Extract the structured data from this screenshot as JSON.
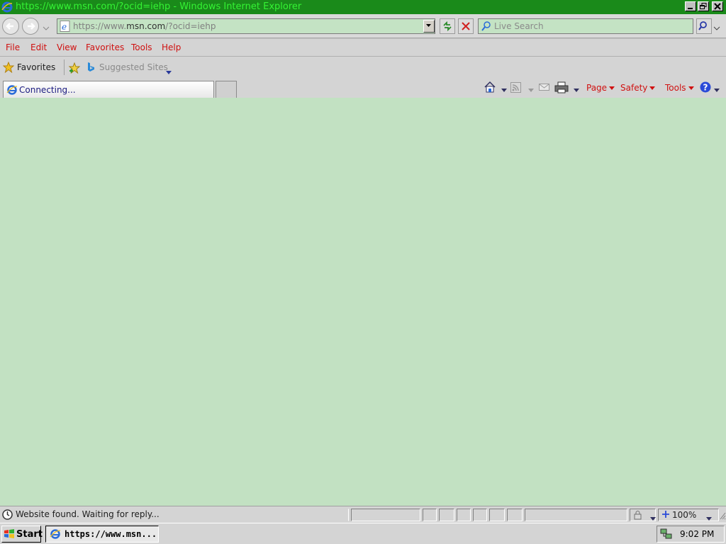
{
  "window": {
    "title": "https://www.msn.com/?ocid=iehp - Windows Internet Explorer"
  },
  "address_bar": {
    "url_prefix": "https://www.",
    "url_domain": "msn.com",
    "url_suffix": "/?ocid=iehp"
  },
  "search": {
    "placeholder": "Live Search"
  },
  "menu": [
    "File",
    "Edit",
    "View",
    "Favorites",
    "Tools",
    "Help"
  ],
  "favorites_bar": {
    "favorites_label": "Favorites",
    "suggested_sites_label": "Suggested Sites"
  },
  "tab": {
    "label": "Connecting..."
  },
  "command_bar": {
    "page_label": "Page",
    "safety_label": "Safety",
    "tools_label": "Tools"
  },
  "status_bar": {
    "text": "Website found. Waiting for reply...",
    "zoom": "100%"
  },
  "taskbar": {
    "start_label": "Start",
    "task_label": "https://www.msn...",
    "clock": "9:02 PM"
  },
  "colors": {
    "titlebar_bg": "#1a8a1a",
    "title_text": "#34f334",
    "menu_text": "#d01010",
    "content_bg": "#c2e1c2"
  }
}
